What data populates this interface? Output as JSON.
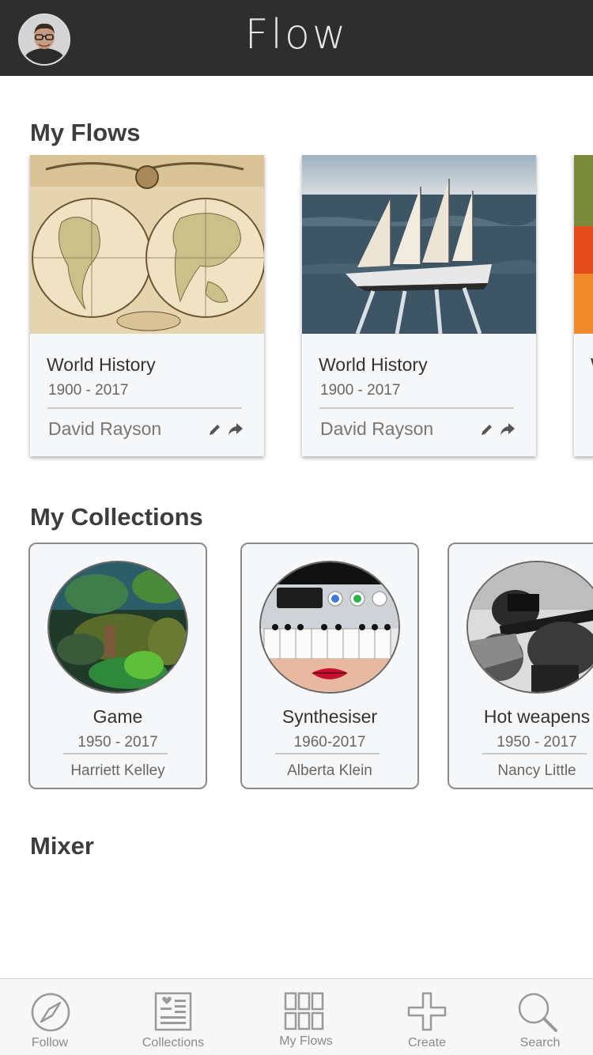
{
  "header": {
    "title": "Flow",
    "avatar_alt": "User avatar"
  },
  "sections": {
    "flows_title": "My Flows",
    "collections_title": "My Collections",
    "mixer_title": "Mixer"
  },
  "flows": [
    {
      "title": "World History",
      "dates": "1900 - 2017",
      "author": "David Rayson",
      "image": "antique-world-map"
    },
    {
      "title": "World History",
      "dates": "1900 - 2017",
      "author": "David Rayson",
      "image": "sailing-ship"
    },
    {
      "title": "W",
      "dates": "",
      "author": "",
      "image": "abstract-painting"
    }
  ],
  "collections": [
    {
      "title": "Game",
      "dates": "1950 - 2017",
      "author": "Harriett Kelley",
      "image": "jungle-game-scene"
    },
    {
      "title": "Synthesiser",
      "dates": "1960-2017",
      "author": "Alberta Klein",
      "image": "synthesiser-keyboard"
    },
    {
      "title": "Hot weapens",
      "dates": "1950 - 2017",
      "author": "Nancy Little",
      "image": "vintage-soldiers"
    }
  ],
  "tabs": [
    {
      "label": "Follow",
      "icon": "compass-icon"
    },
    {
      "label": "Collections",
      "icon": "collections-icon"
    },
    {
      "label": "My Flows",
      "icon": "grid-icon"
    },
    {
      "label": "Create",
      "icon": "plus-icon"
    },
    {
      "label": "Search",
      "icon": "search-icon"
    }
  ],
  "colors": {
    "header_bg": "#2e2e2e",
    "card_bg": "#f6f7f9",
    "tabbar_bg": "#f7f7f7"
  }
}
